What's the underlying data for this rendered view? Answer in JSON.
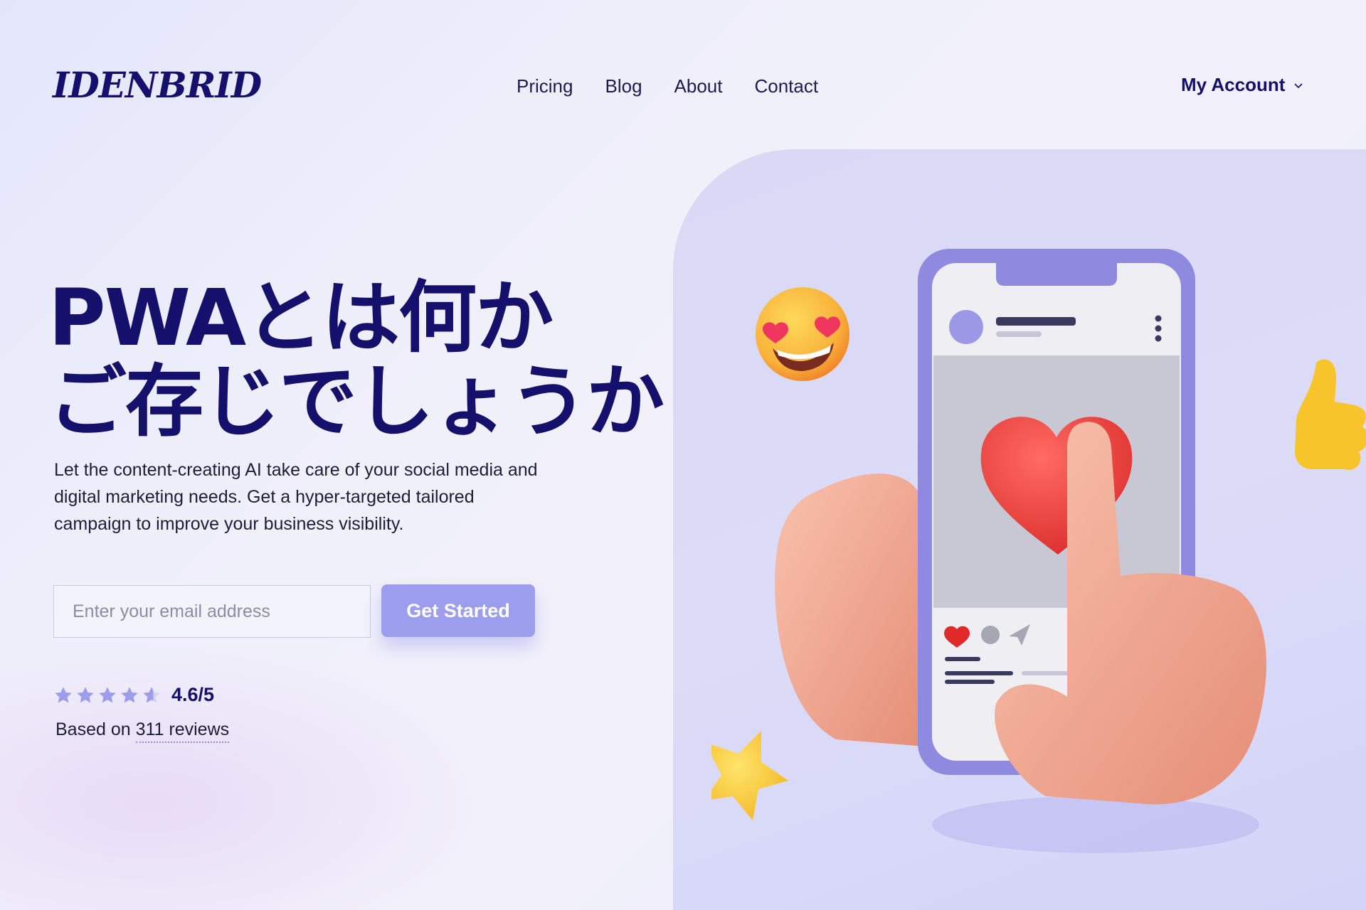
{
  "brand": {
    "logo_text": "IDENBRID"
  },
  "nav": {
    "items": [
      "Pricing",
      "Blog",
      "About",
      "Contact"
    ]
  },
  "account": {
    "label": "My Account",
    "icon": "chevron-down-icon"
  },
  "hero": {
    "title_line1": "PWAとは何か",
    "title_line2": "ご存じでしょうか",
    "description": "Let the content-creating AI take care of your social media and digital marketing needs. Get a hyper-targeted tailored campaign to improve your business visibility.",
    "email_placeholder": "Enter your email address",
    "cta_label": "Get Started"
  },
  "rating": {
    "stars_value": 4.6,
    "stars_max": 5,
    "score_text": "4.6/5",
    "reviews_prefix": "Based on",
    "reviews_link": "311 reviews"
  },
  "colors": {
    "brand_navy": "#14106b",
    "accent_purple": "#9d9ded",
    "panel_bg": "#d9d8f6",
    "star_color": "#9d9ded"
  }
}
